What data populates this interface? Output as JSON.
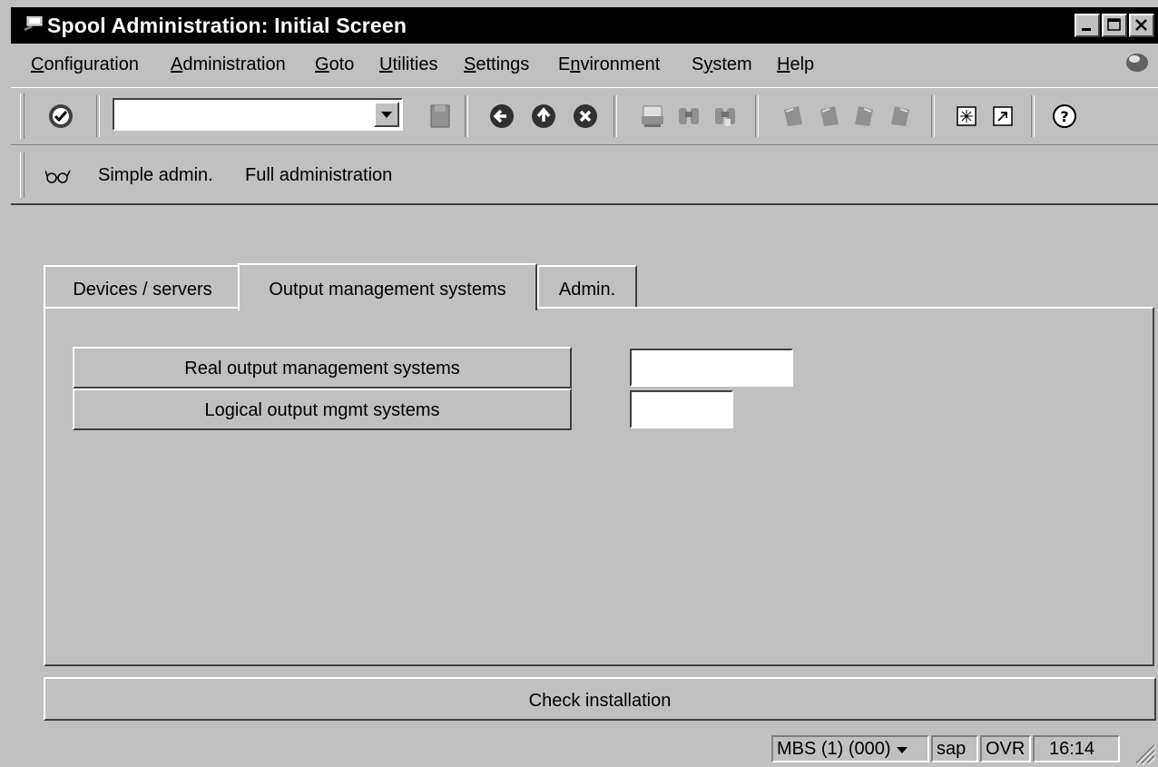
{
  "window": {
    "title": "Spool Administration: Initial Screen"
  },
  "menu": {
    "items": [
      {
        "label": "Configuration",
        "accel": "C",
        "rest": "onfiguration"
      },
      {
        "label": "Administration",
        "accel": "A",
        "rest": "dministration"
      },
      {
        "label": "Goto",
        "accel": "G",
        "rest": "oto"
      },
      {
        "label": "Utilities",
        "accel": "U",
        "rest": "tilities"
      },
      {
        "label": "Settings",
        "accel": "S",
        "rest": "ettings"
      },
      {
        "label": "Environment",
        "accel": "n",
        "pre": "E",
        "rest": "vironment"
      },
      {
        "label": "System",
        "accel": "y",
        "pre": "S",
        "rest": "stem"
      },
      {
        "label": "Help",
        "accel": "H",
        "rest": "elp"
      }
    ]
  },
  "toolbar": {
    "command_value": "",
    "icons": [
      "enter-icon",
      "save-icon",
      "back-icon",
      "exit-icon",
      "cancel-icon",
      "print-icon",
      "find-icon",
      "find-next-icon",
      "first-page-icon",
      "previous-page-icon",
      "next-page-icon",
      "last-page-icon",
      "create-session-icon",
      "shortcut-icon",
      "help-icon"
    ]
  },
  "app_toolbar": {
    "simple_admin": "Simple admin.",
    "full_admin": "Full administration"
  },
  "tabs": [
    {
      "label": "Devices / servers",
      "active": false
    },
    {
      "label": "Output management systems",
      "active": true
    },
    {
      "label": "Admin.",
      "active": false
    }
  ],
  "panel": {
    "real_oms_button": "Real output management systems",
    "real_oms_value": "",
    "logical_oms_button": "Logical output mgmt systems",
    "logical_oms_value": ""
  },
  "check_installation": "Check installation",
  "status": {
    "system": "MBS (1) (000)",
    "server": "sap",
    "mode": "OVR",
    "time": "16:14"
  },
  "colors": {
    "background": "#c0c0c0",
    "titlebar": "#000000"
  }
}
